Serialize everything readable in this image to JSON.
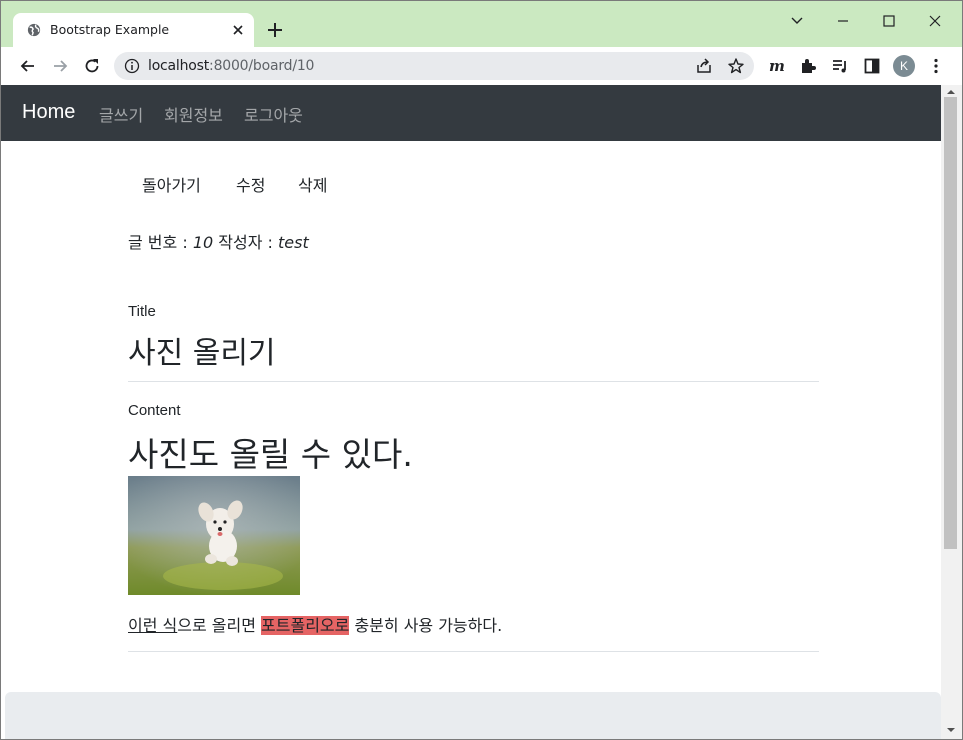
{
  "browser": {
    "tab_title": "Bootstrap Example",
    "url_host": "localhost",
    "url_rest": ":8000/board/10",
    "avatar_initial": "K"
  },
  "navbar": {
    "brand": "Home",
    "links": [
      "글쓰기",
      "회원정보",
      "로그아웃"
    ]
  },
  "actions": {
    "back_label": "돌아가기",
    "edit_label": "수정",
    "delete_label": "삭제"
  },
  "post": {
    "number_label": "글 번호 : ",
    "number": "10",
    "author_label": " 작성자 : ",
    "author": "test",
    "title_label": "Title",
    "title": "사진 올리기",
    "content_label": "Content",
    "content_heading": "사진도 올릴 수 있다.",
    "paragraph_underlined": "이런 식",
    "paragraph_part1": "으로 올리면 ",
    "paragraph_highlighted": "포트폴리오로",
    "paragraph_part2": " 충분히 사용 가능하다."
  },
  "colors": {
    "titlebar": "#cbe9c1",
    "navbar": "#343a40",
    "highlight": "#e56464",
    "footer": "#e9ecef"
  },
  "icons": [
    "globe-icon",
    "close-icon",
    "plus-icon",
    "chevron-down-icon",
    "minimize-icon",
    "maximize-icon",
    "close-window-icon",
    "back-icon",
    "forward-icon",
    "reload-icon",
    "info-icon",
    "share-icon",
    "star-icon",
    "m-extension-icon",
    "puzzle-icon",
    "media-icon",
    "sidebar-icon",
    "more-icon"
  ]
}
